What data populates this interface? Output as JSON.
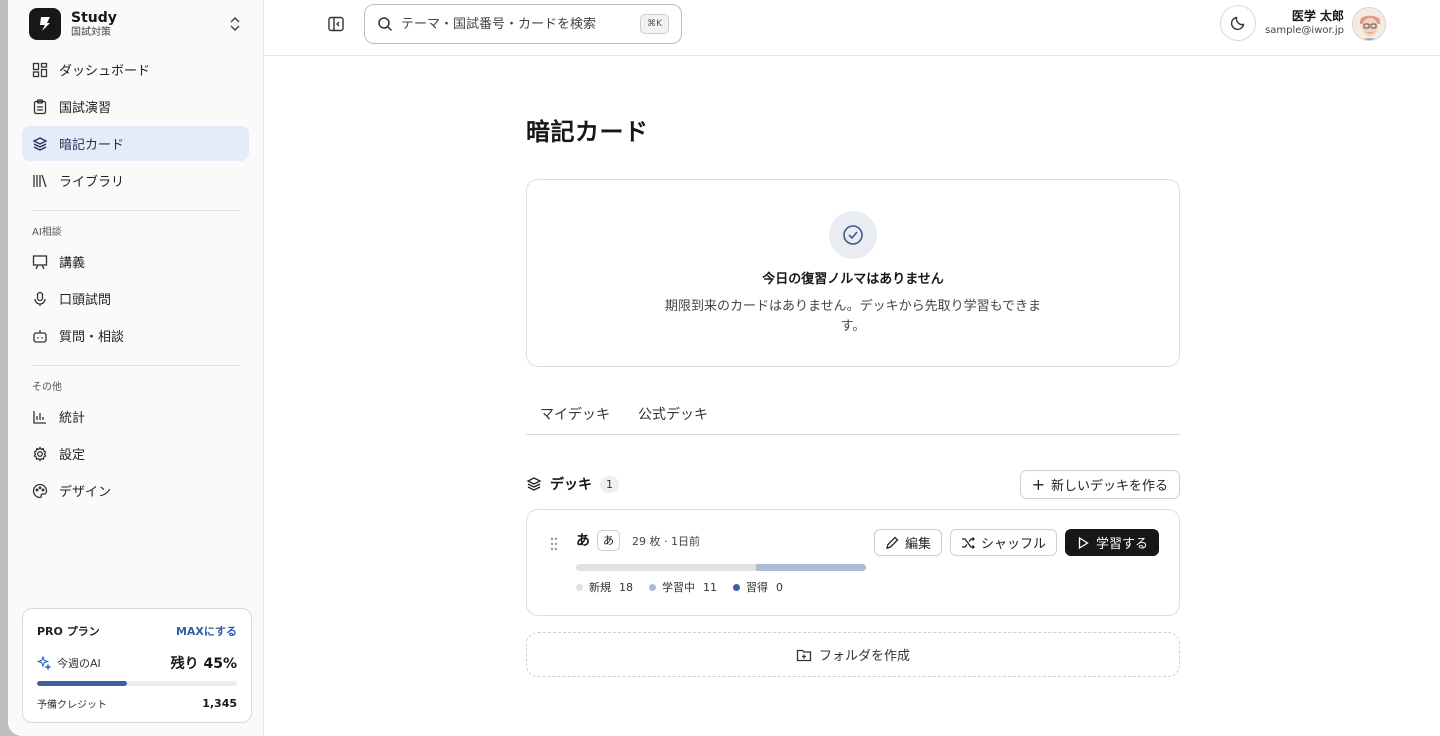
{
  "brand": {
    "name": "Study",
    "sub": "国試対策"
  },
  "nav": {
    "main": [
      {
        "label": "ダッシュボード",
        "icon": "dashboard-icon"
      },
      {
        "label": "国試演習",
        "icon": "clipboard-icon"
      },
      {
        "label": "暗記カード",
        "icon": "layers-icon",
        "active": true
      },
      {
        "label": "ライブラリ",
        "icon": "library-icon"
      }
    ],
    "ai_section_label": "AI相談",
    "ai": [
      {
        "label": "講義",
        "icon": "presentation-icon"
      },
      {
        "label": "口頭試問",
        "icon": "mic-icon"
      },
      {
        "label": "質問・相談",
        "icon": "bot-icon"
      }
    ],
    "other_section_label": "その他",
    "other": [
      {
        "label": "統計",
        "icon": "bar-chart-icon"
      },
      {
        "label": "設定",
        "icon": "gear-icon"
      },
      {
        "label": "デザイン",
        "icon": "palette-icon"
      }
    ]
  },
  "plan": {
    "title": "PRO プラン",
    "upgrade_label": "MAXにする",
    "ai_label": "今週のAI",
    "ai_remaining": "残り 45%",
    "ai_remaining_fraction": 0.45,
    "credit_label": "予備クレジット",
    "credit_value": "1,345"
  },
  "header": {
    "search_placeholder": "テーマ・国試番号・カードを検索",
    "shortcut": "⌘K",
    "user_name": "医学 太郎",
    "user_email": "sample@iwor.jp"
  },
  "page": {
    "title": "暗記カード",
    "empty_title": "今日の復習ノルマはありません",
    "empty_desc": "期限到来のカードはありません。デッキから先取り学習もできます。"
  },
  "tabs": [
    "マイデッキ",
    "公式デッキ"
  ],
  "decks": {
    "heading": "デッキ",
    "count": "1",
    "new_button": "新しいデッキを作る",
    "items": [
      {
        "name": "あ",
        "tag": "あ",
        "meta": "29 枚 · 1日前",
        "progress": {
          "new": 18,
          "learning": 11,
          "learned": 0
        },
        "legend": [
          {
            "label": "新規",
            "value": "18",
            "color": "#e2e2e2"
          },
          {
            "label": "学習中",
            "value": "11",
            "color": "#adbcd4"
          },
          {
            "label": "習得",
            "value": "0",
            "color": "#3c5fa0"
          }
        ],
        "edit_label": "編集",
        "shuffle_label": "シャッフル",
        "study_label": "学習する"
      }
    ],
    "folder_button": "フォルダを作成"
  }
}
